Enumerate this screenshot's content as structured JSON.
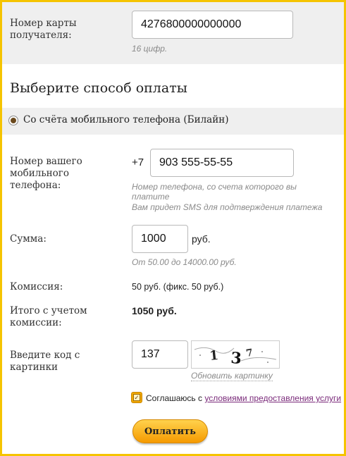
{
  "card": {
    "label": "Номер карты получателя:",
    "value": "4276800000000000",
    "hint": "16 цифр."
  },
  "heading": "Выберите способ оплаты",
  "method": {
    "label": "Со счёта мобильного телефона (Билайн)",
    "selected": true
  },
  "phone": {
    "label": "Номер вашего мобильного телефона:",
    "prefix": "+7",
    "value": "903 555-55-55",
    "hint1": "Номер телефона, со счета которого вы платите",
    "hint2": "Вам придет SMS для подтверждения платежа"
  },
  "amount": {
    "label": "Сумма:",
    "value": "1000",
    "currency": "руб.",
    "hint": "От 50.00 до 14000.00 руб."
  },
  "commission": {
    "label": "Комиссия:",
    "value": "50 руб. (фикс. 50 руб.)"
  },
  "total": {
    "label": "Итого с учетом комиссии:",
    "value": "1050 руб."
  },
  "captcha": {
    "label": "Введите код с картинки",
    "value": "137",
    "image_text": "137",
    "refresh_label": "Обновить картинку"
  },
  "agreement": {
    "checked": true,
    "text": "Соглашаюсь с",
    "link": "условиями предоставления услуги"
  },
  "pay_button": "Оплатить",
  "colors": {
    "accent": "#f5c400",
    "button_top": "#ffd24d",
    "button_bottom": "#f59a00",
    "link": "#7a2a7a"
  }
}
